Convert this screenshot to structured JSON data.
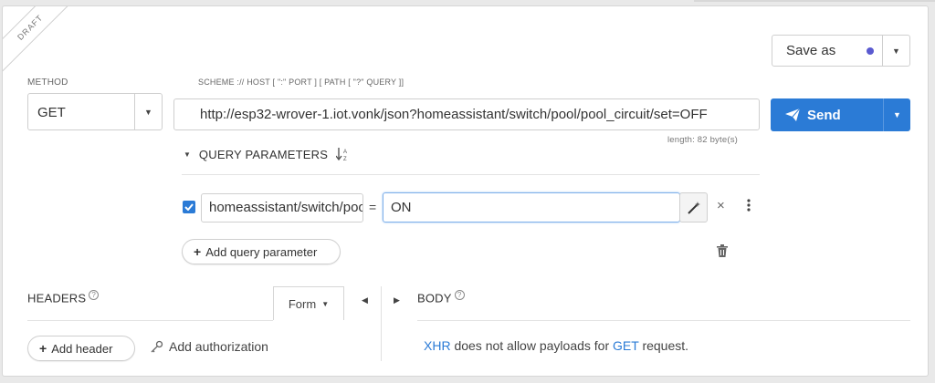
{
  "ribbon": {
    "label": "DRAFT"
  },
  "save_as": {
    "label": "Save as",
    "dot_color": "#5a5ad0"
  },
  "method": {
    "label": "METHOD",
    "value": "GET"
  },
  "url": {
    "hint": "SCHEME :// HOST [ \":\" PORT ] [ PATH [ \"?\" QUERY ]]",
    "value": "http://esp32-wrover-1.iot.vonk/json?homeassistant/switch/pool/pool_circuit/set=OFF",
    "length": "length: 82 byte(s)"
  },
  "send": {
    "label": "Send",
    "color": "#2b7bd6"
  },
  "query_params": {
    "title": "QUERY PARAMETERS",
    "items": [
      {
        "name": "homeassistant/switch/pool/pool_circuit/set",
        "equals": "=",
        "value": "ON",
        "checked": true
      }
    ],
    "add_label": "Add query parameter"
  },
  "headers": {
    "title": "HEADERS",
    "help": "?",
    "form_tab": "Form",
    "add_header": "Add header",
    "add_authorization": "Add authorization"
  },
  "body": {
    "title": "BODY",
    "help": "?",
    "message_xhr": "XHR",
    "message_mid": "does not allow payloads for",
    "message_get": "GET",
    "message_end": "request."
  }
}
